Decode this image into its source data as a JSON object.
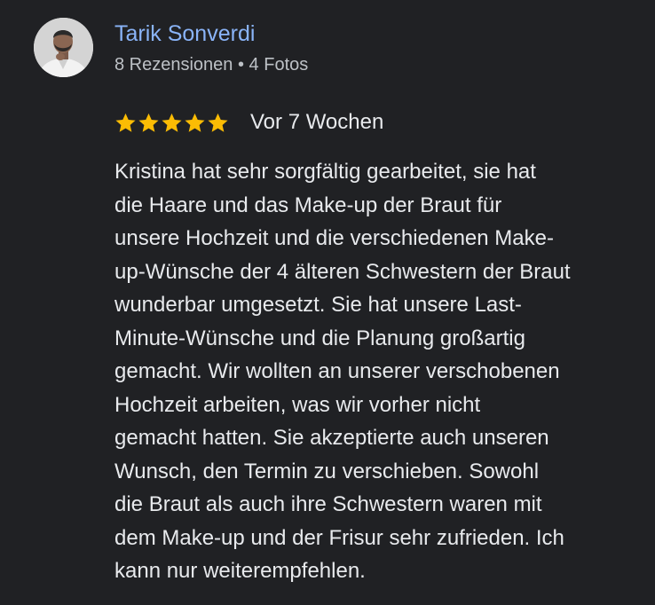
{
  "review": {
    "author": {
      "name": "Tarik Sonverdi",
      "meta": "8 Rezensionen • 4 Fotos"
    },
    "rating": {
      "stars": 5,
      "max": 5,
      "color": "#fbbc04"
    },
    "date": "Vor 7 Wochen",
    "text_lines": [
      "Kristina hat sehr sorgfältig gearbeitet, sie hat",
      "die Haare und das Make-up der Braut für",
      "unsere Hochzeit und die verschiedenen Make-",
      "up-Wünsche der 4 älteren Schwestern der Braut",
      "wunderbar umgesetzt. Sie hat unsere Last-",
      "Minute-Wünsche und die Planung großartig",
      "gemacht. Wir wollten an unserer verschobenen",
      "Hochzeit arbeiten, was wir vorher nicht",
      "gemacht hatten. Sie akzeptierte auch unseren",
      "Wunsch, den Termin zu verschieben. Sowohl",
      "die Braut als auch ihre Schwestern waren mit",
      "dem Make-up und der Frisur sehr zufrieden. Ich",
      "kann nur weiterempfehlen."
    ]
  },
  "colors": {
    "background": "#202124",
    "name": "#8ab4f8",
    "meta": "#bdc1c6",
    "text": "#e8eaed"
  }
}
